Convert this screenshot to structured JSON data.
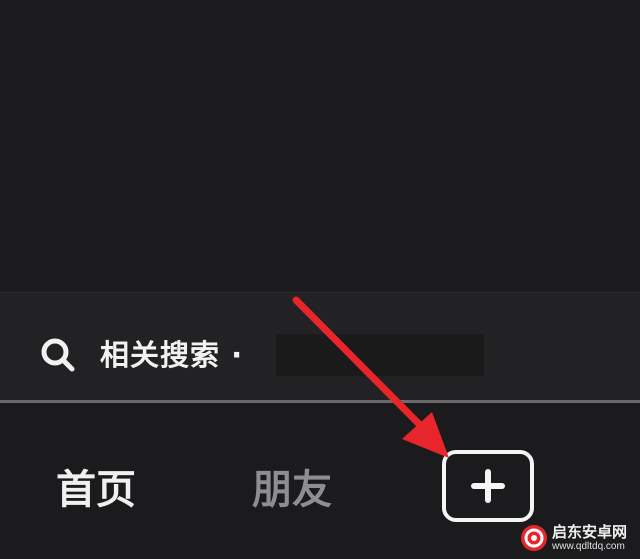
{
  "search": {
    "prefix": "相关搜索 ·",
    "icon": "search-icon"
  },
  "tabs": [
    {
      "label": "首页",
      "active": true
    },
    {
      "label": "朋友",
      "active": false
    }
  ],
  "add_button": {
    "icon": "plus-icon"
  },
  "annotation": {
    "arrow_color": "#e8252a",
    "icon": "red-arrow"
  },
  "watermark": {
    "title": "启东安卓网",
    "url": "www.qdltdq.com",
    "logo_color": "#e8252a"
  },
  "colors": {
    "background": "#1b1b1d",
    "search_bar": "#222224",
    "active_tab": "#f0f0f0",
    "inactive_tab": "#8e8e90",
    "divider": "#6a6a6c"
  }
}
